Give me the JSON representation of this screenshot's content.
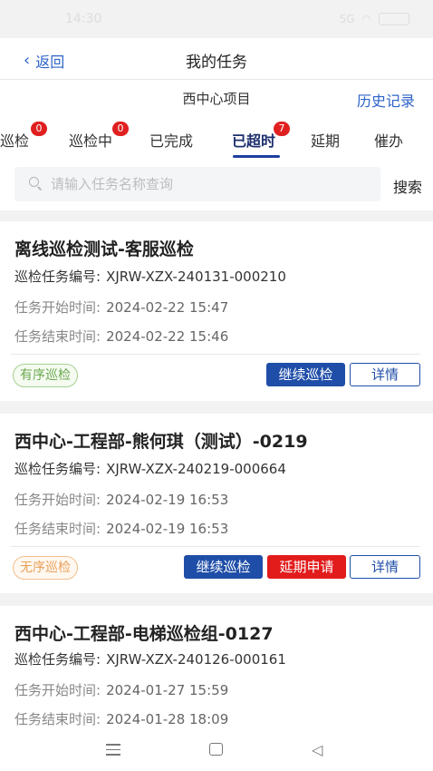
{
  "status_bar": {
    "time": "14:30",
    "signal": "5G",
    "battery": ""
  },
  "nav": {
    "back_label": "返回",
    "title": "我的任务"
  },
  "project": {
    "name": "西中心项目",
    "history_label": "历史记录"
  },
  "tabs": [
    {
      "label": "待巡检",
      "badge": "0"
    },
    {
      "label": "巡检中",
      "badge": "0"
    },
    {
      "label": "已完成",
      "badge": ""
    },
    {
      "label": "已超时",
      "badge": "7",
      "active": true
    },
    {
      "label": "延期",
      "badge": ""
    },
    {
      "label": "催办",
      "badge": ""
    }
  ],
  "search": {
    "placeholder": "请输入任务名称查询",
    "value": "",
    "button_label": "搜索"
  },
  "labels": {
    "task_no": "巡检任务编号:",
    "start": "任务开始时间:",
    "end": "任务结束时间:"
  },
  "tasks": [
    {
      "title": "离线巡检测试-客服巡检",
      "task_no": "XJRW-XZX-240131-000210",
      "start": "2024-02-22 15:47",
      "end": "2024-02-22 15:46",
      "tag": "有序巡检",
      "actions": {
        "continue": "继续巡检",
        "delay": "",
        "detail": "详情"
      }
    },
    {
      "title": "西中心-工程部-熊何琪（测试）-0219",
      "task_no": "XJRW-XZX-240219-000664",
      "start": "2024-02-19 16:53",
      "end": "2024-02-19 16:53",
      "tag": "无序巡检",
      "actions": {
        "continue": "继续巡检",
        "delay": "延期申请",
        "detail": "详情"
      }
    },
    {
      "title": "西中心-工程部-电梯巡检组-0127",
      "task_no": "XJRW-XZX-240126-000161",
      "start": "2024-01-27 15:59",
      "end": "2024-01-28 18:09",
      "tag": "",
      "actions": {
        "continue": "",
        "delay": "",
        "detail": ""
      }
    }
  ],
  "colors": {
    "accent": "#1f4ea8",
    "badge": "#e02020",
    "link": "#2e64c8"
  }
}
